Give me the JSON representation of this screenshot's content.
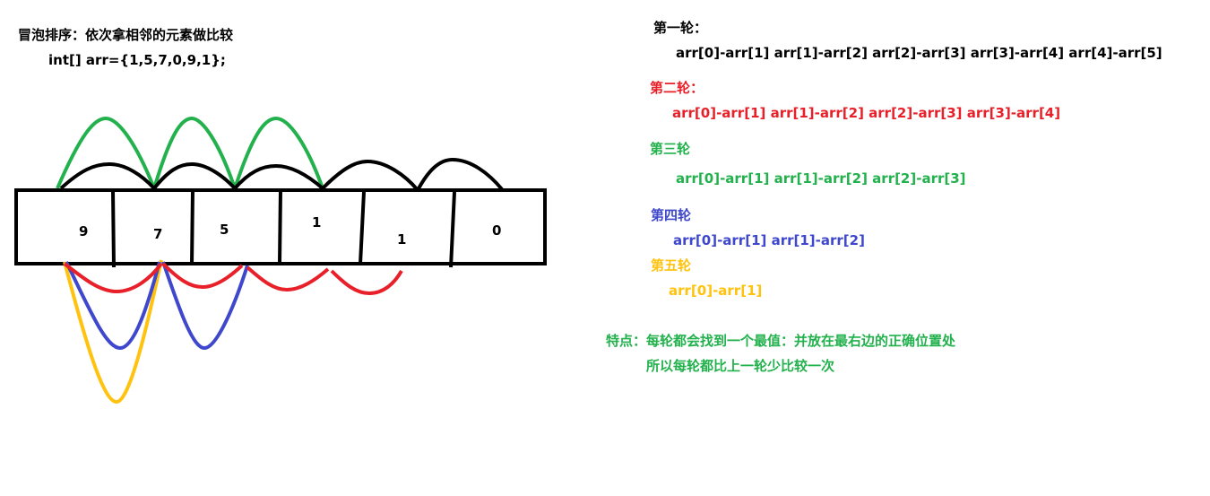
{
  "title": "冒泡排序：依次拿相邻的元素做比较",
  "code": "int[] arr={1,5,7,0,9,1};",
  "array_cells": [
    "9",
    "7",
    "5",
    "1",
    "1",
    "0"
  ],
  "rounds": [
    {
      "title": "第一轮：",
      "line": "arr[0]-arr[1] arr[1]-arr[2] arr[2]-arr[3] arr[3]-arr[4] arr[4]-arr[5]",
      "color": "#000000"
    },
    {
      "title": "第二轮：",
      "line": "arr[0]-arr[1] arr[1]-arr[2] arr[2]-arr[3] arr[3]-arr[4]",
      "color": "#e8202a"
    },
    {
      "title": "第三轮",
      "line": "arr[0]-arr[1]  arr[1]-arr[2]   arr[2]-arr[3]",
      "color": "#22b14c"
    },
    {
      "title": "第四轮",
      "line": "arr[0]-arr[1] arr[1]-arr[2]",
      "color": "#3f48cc"
    },
    {
      "title": "第五轮",
      "line": "arr[0]-arr[1]",
      "color": "#ffc20e"
    }
  ],
  "feature": {
    "line1": "特点：每轮都会找到一个最值：并放在最右边的正确位置处",
    "line2": "所以每轮都比上一轮少比较一次",
    "color": "#22b14c"
  },
  "colors": {
    "black": "#000000",
    "red": "#e8202a",
    "green": "#22b14c",
    "blue": "#3f48cc",
    "yellow": "#ffc20e"
  }
}
